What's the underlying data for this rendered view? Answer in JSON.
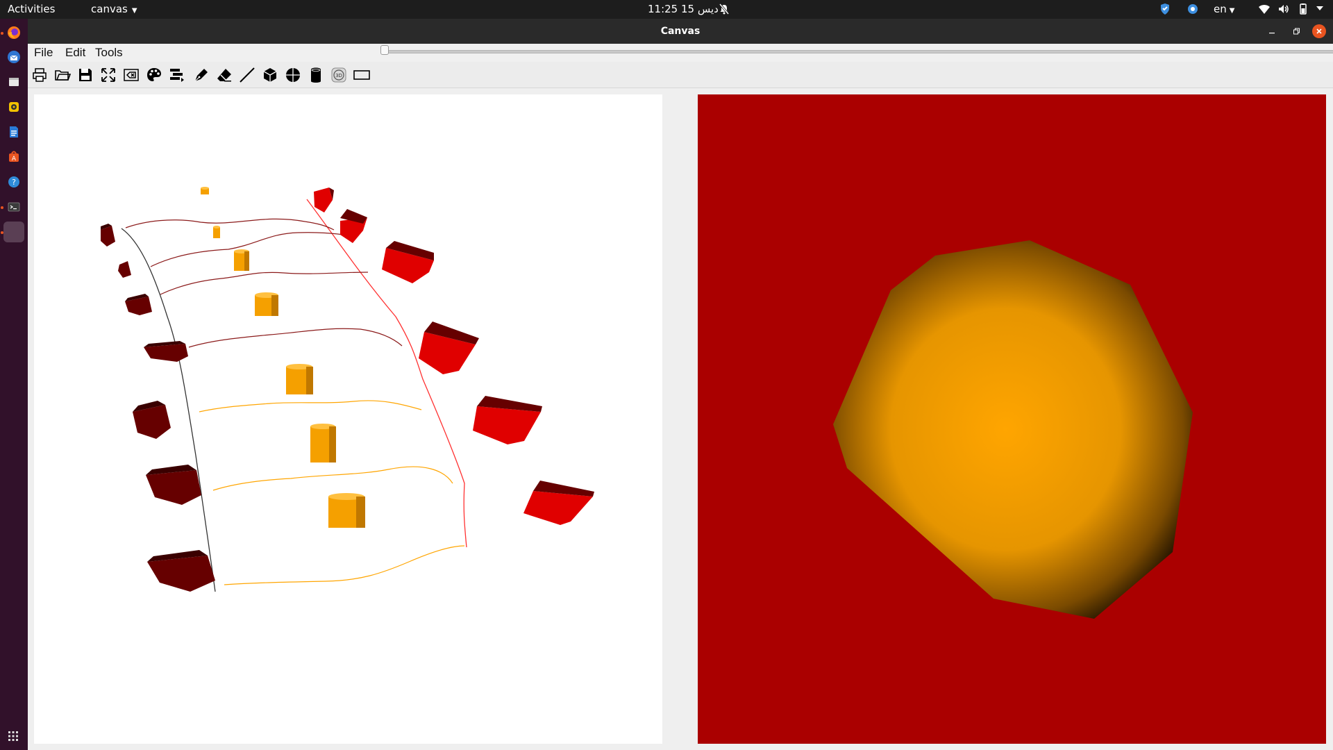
{
  "topbar": {
    "activities": "Activities",
    "app_menu": "canvas",
    "clock": "11:25  دیس 15",
    "language": "en",
    "icons": [
      "notifications-muted-icon",
      "shield-icon",
      "chat-icon",
      "wifi-icon",
      "volume-icon",
      "battery-icon",
      "power-caret-icon"
    ]
  },
  "dock": {
    "items": [
      "firefox-icon",
      "thunderbird-icon",
      "files-icon",
      "rhythmbox-icon",
      "writer-icon",
      "software-icon",
      "help-icon",
      "terminal-icon",
      "canvas-app-icon"
    ],
    "show_apps": "apps-grid-icon"
  },
  "window": {
    "title": "Canvas",
    "controls": [
      "minimize-icon",
      "maximize-icon",
      "close-icon"
    ]
  },
  "menubar": {
    "items": [
      "File",
      "Edit",
      "Tools"
    ]
  },
  "toolbar": {
    "tools": [
      "print-icon",
      "open-folder-icon",
      "save-icon",
      "fit-view-icon",
      "clear-icon",
      "palette-icon",
      "layers-icon",
      "pen-icon",
      "eraser-icon",
      "line-icon",
      "cube-icon",
      "sphere-icon",
      "cylinder-icon",
      "3d-toggle-icon",
      "rectangle-icon"
    ],
    "slider_value": 0
  },
  "colors": {
    "viewport_3d_background": "#aa0000",
    "sphere": "#ffa500",
    "cube_front": "#e00000",
    "cube_back": "#660000",
    "cylinder": "#f5a000",
    "stroke_dark": "#333333",
    "stroke_red": "#ff3030",
    "stroke_maroon": "#8b1a1a",
    "stroke_orange": "#ffa500"
  }
}
